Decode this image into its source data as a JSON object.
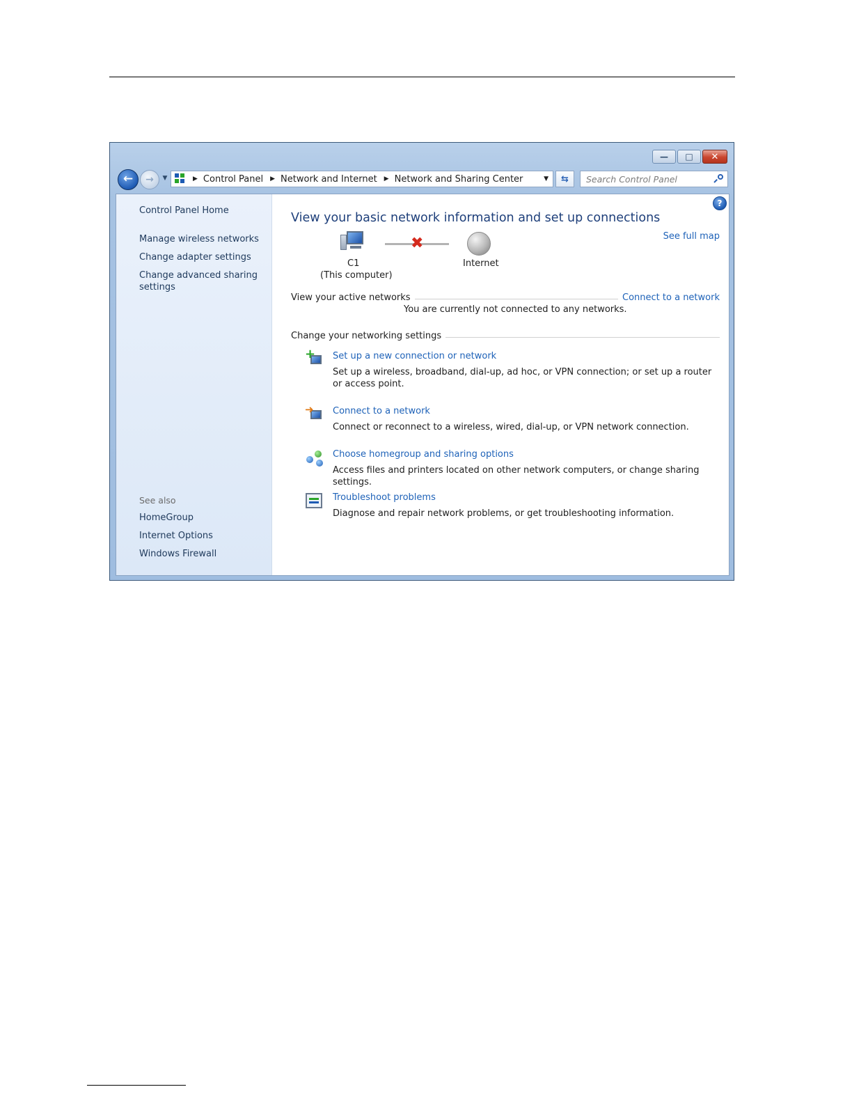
{
  "window": {
    "caption_buttons": [
      "minimize-icon",
      "maximize-icon",
      "close-icon"
    ]
  },
  "navigation": {
    "back_icon": "back-arrow-icon",
    "forward_icon": "forward-arrow-icon",
    "recent_icon": "chevron-down-icon"
  },
  "address_bar": {
    "breadcrumbs": [
      "Control Panel",
      "Network and Internet",
      "Network and Sharing Center"
    ],
    "refresh_icon": "refresh-icon"
  },
  "search": {
    "placeholder": "Search Control Panel",
    "value": ""
  },
  "sidebar": {
    "home": "Control Panel Home",
    "items": [
      "Manage wireless networks",
      "Change adapter settings",
      "Change advanced sharing settings"
    ],
    "see_also_label": "See also",
    "see_also": [
      "HomeGroup",
      "Internet Options",
      "Windows Firewall"
    ]
  },
  "main": {
    "title": "View your basic network information and set up connections",
    "see_full_map": "See full map",
    "map": {
      "computer_name": "C1",
      "computer_sub": "(This computer)",
      "internet_label": "Internet",
      "status": "disconnected"
    },
    "active_networks_label": "View your active networks",
    "connect_link": "Connect to a network",
    "no_networks": "You are currently not connected to any networks.",
    "settings_label": "Change your networking settings",
    "tasks": [
      {
        "title": "Set up a new connection or network",
        "desc": "Set up a wireless, broadband, dial-up, ad hoc, or VPN connection; or set up a router or access point.",
        "icon": "new-connection-icon"
      },
      {
        "title": "Connect to a network",
        "desc": "Connect or reconnect to a wireless, wired, dial-up, or VPN network connection.",
        "icon": "connect-network-icon"
      },
      {
        "title": "Choose homegroup and sharing options",
        "desc": "Access files and printers located on other network computers, or change sharing settings.",
        "icon": "homegroup-icon"
      },
      {
        "title": "Troubleshoot problems",
        "desc": "Diagnose and repair network problems, or get troubleshooting information.",
        "icon": "troubleshoot-icon"
      }
    ]
  }
}
